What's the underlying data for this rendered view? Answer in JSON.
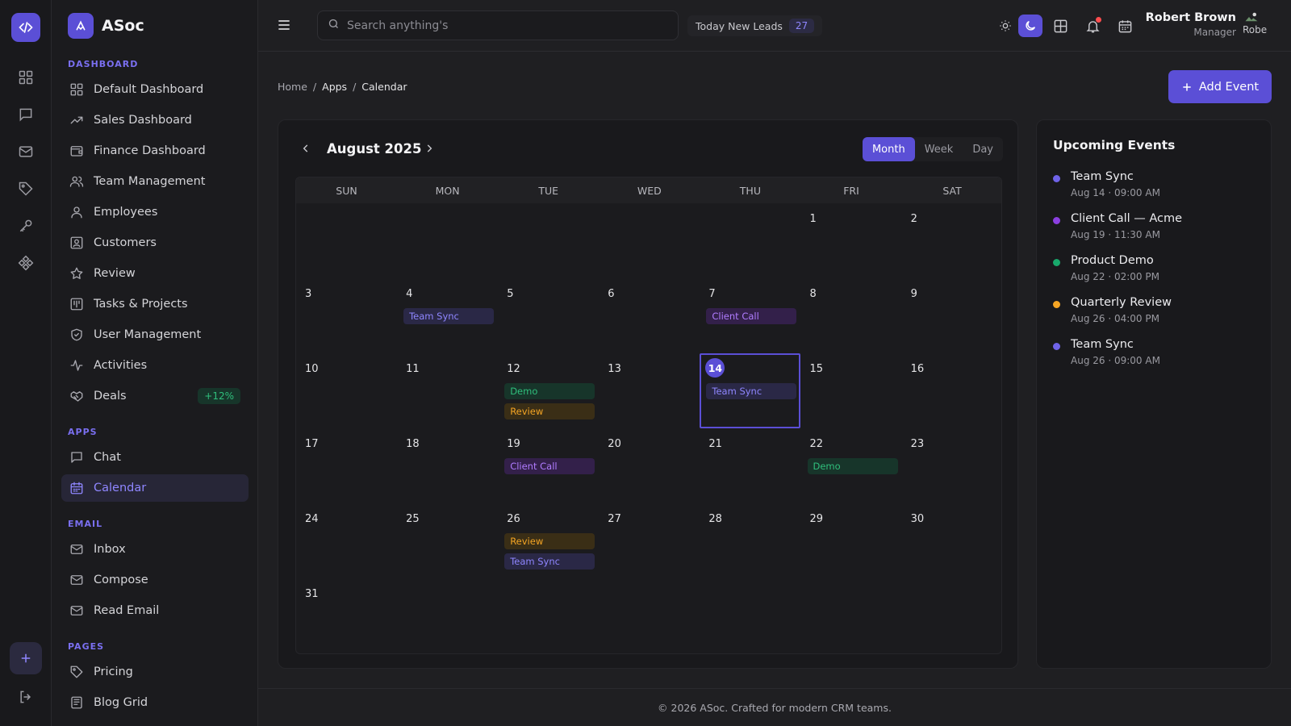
{
  "brand": {
    "name": "ASoc"
  },
  "sidebar": {
    "sections": [
      {
        "title": "DASHBOARD",
        "items": [
          {
            "label": "Default Dashboard",
            "icon": "grid-icon"
          },
          {
            "label": "Sales Dashboard",
            "icon": "trend-up-icon"
          },
          {
            "label": "Finance Dashboard",
            "icon": "wallet-icon"
          },
          {
            "label": "Team Management",
            "icon": "users-icon"
          },
          {
            "label": "Employees",
            "icon": "user-icon"
          },
          {
            "label": "Customers",
            "icon": "id-card-icon"
          },
          {
            "label": "Review",
            "icon": "star-icon"
          },
          {
            "label": "Tasks & Projects",
            "icon": "kanban-icon"
          },
          {
            "label": "User Management",
            "icon": "shield-icon"
          },
          {
            "label": "Activities",
            "icon": "activity-icon"
          },
          {
            "label": "Deals",
            "icon": "handshake-icon",
            "badge": "+12%"
          }
        ]
      },
      {
        "title": "APPS",
        "items": [
          {
            "label": "Chat",
            "icon": "chat-icon"
          },
          {
            "label": "Calendar",
            "icon": "calendar-icon",
            "active": true
          }
        ]
      },
      {
        "title": "EMAIL",
        "items": [
          {
            "label": "Inbox",
            "icon": "mail-icon"
          },
          {
            "label": "Compose",
            "icon": "mail-icon"
          },
          {
            "label": "Read Email",
            "icon": "mail-icon"
          }
        ]
      },
      {
        "title": "PAGES",
        "items": [
          {
            "label": "Pricing",
            "icon": "tag-icon"
          },
          {
            "label": "Blog Grid",
            "icon": "newspaper-icon"
          }
        ]
      }
    ]
  },
  "topbar": {
    "search_placeholder": "Search anything's",
    "leads_label": "Today New Leads",
    "leads_count": "27",
    "user_name": "Robert Brown",
    "user_role": "Manager",
    "avatar_alt": "Robe"
  },
  "breadcrumb": {
    "home": "Home",
    "apps": "Apps",
    "current": "Calendar"
  },
  "add_event_label": "Add Event",
  "calendar": {
    "month_title": "August 2025",
    "views": [
      "Month",
      "Week",
      "Day"
    ],
    "active_view": "Month",
    "weekdays": [
      "SUN",
      "MON",
      "TUE",
      "WED",
      "THU",
      "FRI",
      "SAT"
    ],
    "first_weekday_index": 5,
    "days_in_month": 31,
    "today": 14,
    "events": [
      {
        "day": 4,
        "label": "Team Sync",
        "color": "purple"
      },
      {
        "day": 7,
        "label": "Client Call",
        "color": "violet"
      },
      {
        "day": 12,
        "label": "Demo",
        "color": "green"
      },
      {
        "day": 12,
        "label": "Review",
        "color": "amber"
      },
      {
        "day": 14,
        "label": "Team Sync",
        "color": "purple"
      },
      {
        "day": 19,
        "label": "Client Call",
        "color": "violet"
      },
      {
        "day": 22,
        "label": "Demo",
        "color": "green"
      },
      {
        "day": 26,
        "label": "Review",
        "color": "amber"
      },
      {
        "day": 26,
        "label": "Team Sync",
        "color": "purple"
      }
    ]
  },
  "upcoming": {
    "title": "Upcoming Events",
    "items": [
      {
        "title": "Team Sync",
        "when": "Aug 14 · 09:00 AM",
        "color": "#6f63e8"
      },
      {
        "title": "Client Call — Acme",
        "when": "Aug 19 · 11:30 AM",
        "color": "#8b3fe0"
      },
      {
        "title": "Product Demo",
        "when": "Aug 22 · 02:00 PM",
        "color": "#18a86b"
      },
      {
        "title": "Quarterly Review",
        "when": "Aug 26 · 04:00 PM",
        "color": "#f5a524"
      },
      {
        "title": "Team Sync",
        "when": "Aug 26 · 09:00 AM",
        "color": "#6f63e8"
      }
    ]
  },
  "footer": "© 2026 ASoc. Crafted for modern CRM teams.",
  "colors": {
    "accent": "#5b4fd6",
    "background": "#1f1f22"
  }
}
